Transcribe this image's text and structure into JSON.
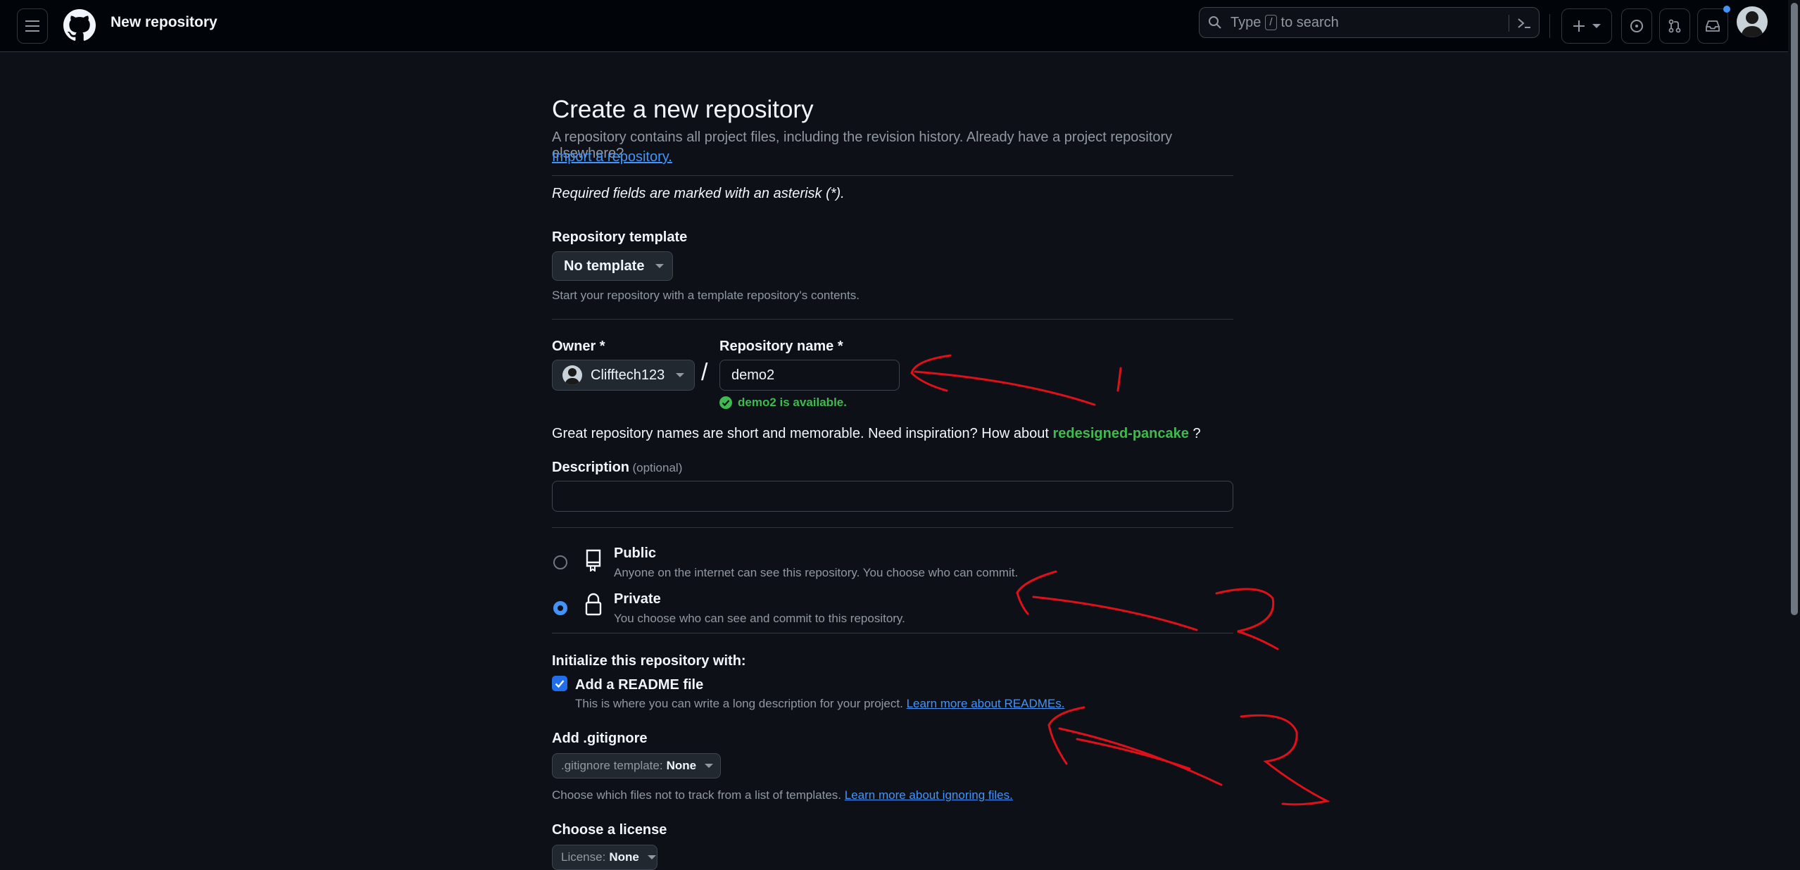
{
  "header": {
    "title": "New repository",
    "search_placeholder_prefix": "Type",
    "search_key": "/",
    "search_placeholder_suffix": "to search",
    "create_icon": "plus-icon"
  },
  "page": {
    "title": "Create a new repository",
    "intro": "A repository contains all project files, including the revision history. Already have a project repository elsewhere?",
    "import_link": "Import a repository.",
    "required_note": "Required fields are marked with an asterisk (*)."
  },
  "template": {
    "label": "Repository template",
    "value": "No template",
    "hint": "Start your repository with a template repository's contents."
  },
  "owner": {
    "label": "Owner *",
    "value": "Clifftech123"
  },
  "repo_name": {
    "label": "Repository name *",
    "value": "demo2",
    "availability": "demo2 is available."
  },
  "suggestion": {
    "text": "Great repository names are short and memorable. Need inspiration? How about",
    "name": "redesigned-pancake",
    "suffix": "?"
  },
  "description": {
    "label": "Description",
    "optional": "(optional)",
    "value": ""
  },
  "visibility": {
    "public_label": "Public",
    "public_desc": "Anyone on the internet can see this repository. You choose who can commit.",
    "private_label": "Private",
    "private_desc": "You choose who can see and commit to this repository.",
    "selected": "Private"
  },
  "initialize": {
    "heading": "Initialize this repository with:",
    "readme_label": "Add a README file",
    "readme_desc": "This is where you can write a long description for your project.",
    "readme_link": "Learn more about READMEs.",
    "readme_checked": true
  },
  "gitignore": {
    "label": "Add .gitignore",
    "select_prefix": ".gitignore template:",
    "select_value": "None",
    "hint": "Choose which files not to track from a list of templates.",
    "hint_link": "Learn more about ignoring files."
  },
  "license": {
    "label": "Choose a license",
    "select_prefix": "License:",
    "select_value": "None"
  },
  "colors": {
    "accent": "#4493f8",
    "success": "#3fb950",
    "annotation": "#e0101a"
  }
}
